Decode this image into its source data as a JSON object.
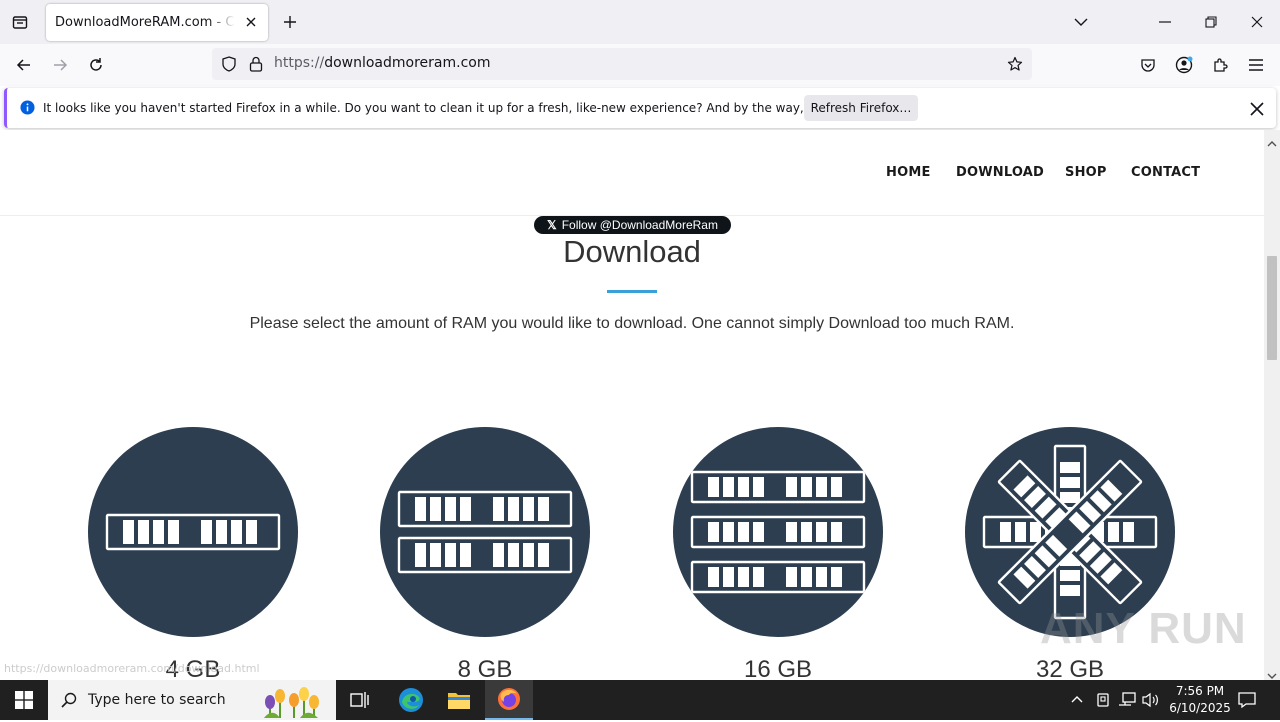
{
  "browser": {
    "tab_title": "DownloadMoreRAM.com - CloudRAM",
    "url_scheme": "https://",
    "url_host": "downloadmoreram.com"
  },
  "notification": {
    "message": "It looks like you haven't started Firefox in a while. Do you want to clean it up for a fresh, like-new experience? And by the way, welcome back!",
    "button_label": "Refresh Firefox…"
  },
  "site": {
    "menu": [
      "HOME",
      "DOWNLOAD",
      "SHOP",
      "CONTACT"
    ],
    "follow_label": "Follow @DownloadMoreRam",
    "title": "Download",
    "intro": "Please select the amount of RAM you would like to download. One cannot simply Download too much RAM.",
    "options": [
      "4 GB",
      "8 GB",
      "16 GB",
      "32 GB"
    ],
    "status_url": "https://downloadmoreram.com/download.html",
    "watermark": "ANY RUN"
  },
  "taskbar": {
    "search_placeholder": "Type here to search",
    "time": "7:56 PM",
    "date": "6/10/2025"
  },
  "colors": {
    "circle": "#2c3e50",
    "accent_underline": "#3aa0d8",
    "notification_accent": "#9059ff"
  }
}
